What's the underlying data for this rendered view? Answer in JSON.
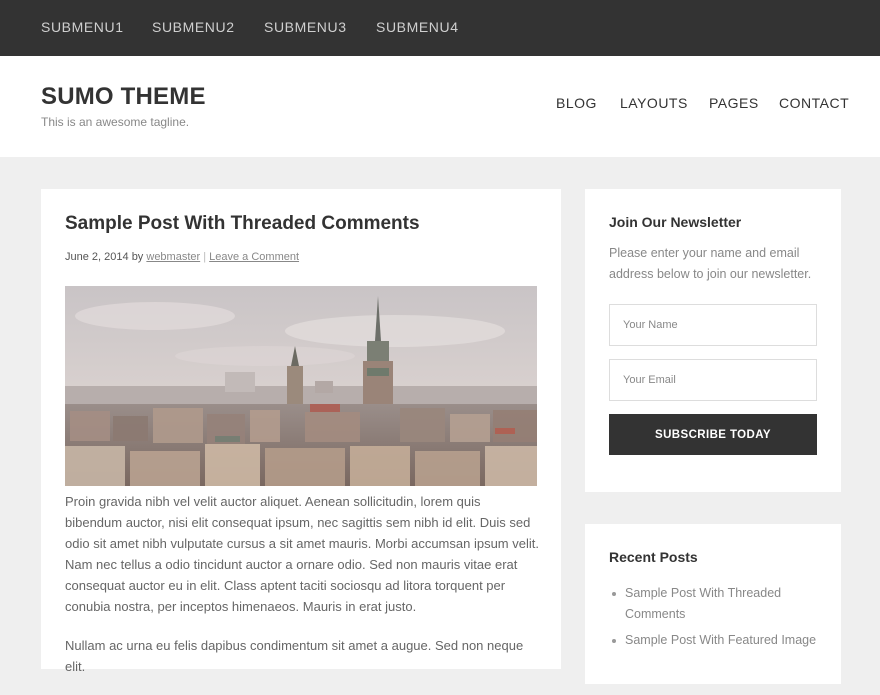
{
  "topbar": {
    "items": [
      "SUBMENU1",
      "SUBMENU2",
      "SUBMENU3",
      "SUBMENU4"
    ]
  },
  "header": {
    "site_title": "SUMO THEME",
    "tagline": "This is an awesome tagline.",
    "nav": [
      "BLOG",
      "LAYOUTS",
      "PAGES",
      "CONTACT"
    ]
  },
  "post": {
    "title": "Sample Post With Threaded Comments",
    "date": "June 2, 2014",
    "by": "by",
    "author": "webmaster",
    "separator": "|",
    "comment_link": "Leave a Comment",
    "paragraphs": [
      "Proin gravida nibh vel velit auctor aliquet. Aenean sollicitudin, lorem quis bibendum auctor, nisi elit consequat ipsum, nec sagittis sem nibh id elit. Duis sed odio sit amet nibh vulputate cursus a sit amet mauris. Morbi accumsan ipsum velit. Nam nec tellus a odio tincidunt auctor a ornare odio. Sed non  mauris vitae erat consequat auctor eu in elit. Class aptent taciti sociosqu ad litora torquent per conubia nostra, per inceptos himenaeos. Mauris in erat justo.",
      "Nullam ac urna eu felis dapibus condimentum sit amet a augue. Sed non neque elit."
    ]
  },
  "newsletter": {
    "title": "Join Our Newsletter",
    "description": "Please enter your name and email address below to join our newsletter.",
    "name_placeholder": "Your Name",
    "email_placeholder": "Your Email",
    "button_label": "SUBSCRIBE TODAY"
  },
  "recent_posts": {
    "title": "Recent Posts",
    "items": [
      "Sample Post With Threaded Comments",
      "Sample Post With Featured Image"
    ]
  },
  "colors": {
    "topbar_bg": "#333333",
    "page_bg": "#efefef",
    "button_bg": "#333333"
  }
}
